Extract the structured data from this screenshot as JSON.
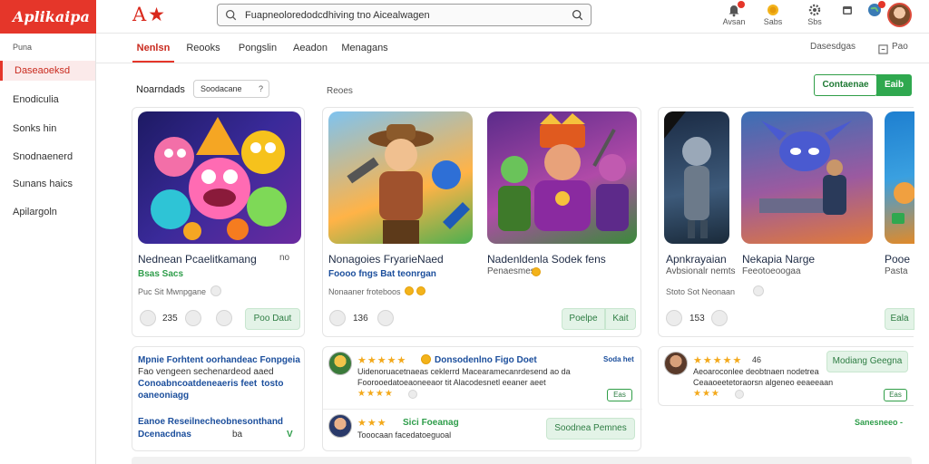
{
  "app": {
    "logo": "Aplikaipa",
    "brand_mark": "A★"
  },
  "search": {
    "value": "Fuapneoloredodcdhiving tno Aicealwagen"
  },
  "header_actions": [
    {
      "label": "Avsan"
    },
    {
      "label": "Sabs"
    },
    {
      "label": "Sbs"
    }
  ],
  "sidebar": {
    "heading": "Puna",
    "items": [
      {
        "label": "Daseaoeksd",
        "active": true
      },
      {
        "label": "Enodiculia"
      },
      {
        "label": "Sonks hin"
      },
      {
        "label": "Snodnaenerd"
      },
      {
        "label": "Sunans haics"
      },
      {
        "label": "Apilargoln"
      }
    ]
  },
  "tabs": [
    {
      "label": "Nenlsn",
      "active": true
    },
    {
      "label": "Reooks"
    },
    {
      "label": "Pongslin"
    },
    {
      "label": "Aeadon"
    },
    {
      "label": "Menagans"
    }
  ],
  "tabs_right": {
    "label": "Dasesdgas",
    "secondary": "Pao"
  },
  "filters": {
    "label": "Noarndads",
    "dropdown": "Soodacane",
    "dropdown_suffix": "?",
    "section_label": "Reoes"
  },
  "actions": {
    "outline_label": "Contaenae",
    "primary_label": "Eaib"
  },
  "cards": [
    {
      "title": "Nednean Pcaelitkamang",
      "title_suffix": "no",
      "sub": "Bsas Sacs",
      "meta": "Puc Sit Mwnpgane",
      "count": "235",
      "button": "Poo Daut"
    },
    {
      "title": "Nonagoies FryarieNaed",
      "sub": "Foooo fngs  Bat  teonrgan",
      "meta": "Nonaaner froteboos",
      "count": "136",
      "button": "Poelpe",
      "button2": "Kait"
    },
    {
      "title": "Nadenldenla  Sodek fens",
      "sub": "Penaesmes"
    },
    {
      "title": "Apnkrayaian",
      "sub": "Avbsionalr nemts",
      "meta": "Stoto Sot Neonaan",
      "count": "153"
    },
    {
      "title": "Nekapia Narge",
      "sub": "Feeotoeoogaa",
      "title_right": "Pooe",
      "sub_right": "Pasta"
    }
  ],
  "cards_extra": {
    "card4_button": "Eala"
  },
  "bottom": {
    "left": {
      "line1": "Mpnie Forhtent oorhandeac Fonpgeia",
      "line2": "Fao vengeen sechenardeod aaed",
      "line3": "Conoabncoatdeneaeris feet",
      "line3_suffix": "tosto",
      "line4": "oaneoniagg",
      "line5": "Eanoe Reseilnecheobnesonthand",
      "line6": "Dcenacdnas",
      "line6_mid": "ba",
      "line6_end": "V"
    },
    "review1": {
      "stars": "★★★★★",
      "title": "Donsodenlno Figo Doet",
      "title_right": "Soda het",
      "line1": "Uidenoruacetnaeas ceklerrd Macearamecanrdesend ao da",
      "line2": "Foorooedatoeaoneeaor tit Alacodesnetl eeaner aeet",
      "tag": "Eas",
      "line3_stars": "★★★★"
    },
    "review2": {
      "stars": "★★★",
      "title": "Sici Foeanag",
      "line1": "Tooocaan facedatoeguoal",
      "button": "Soodnea Pemnes"
    },
    "review3": {
      "stars": "★★★★★",
      "rating": "46",
      "line1": "Aeoaroconlee deobtnaen nodetrea",
      "line2": "Ceaaoeetetoraorsn algeneo eeaeeaan",
      "line3_stars": "★★★",
      "button": "Modiang Geegna",
      "tag": "Eas",
      "footer": "Sanesneeo -"
    }
  },
  "colors": {
    "accent": "#e5362a",
    "green": "#2fa84f",
    "link_blue": "#1b4e9c"
  }
}
